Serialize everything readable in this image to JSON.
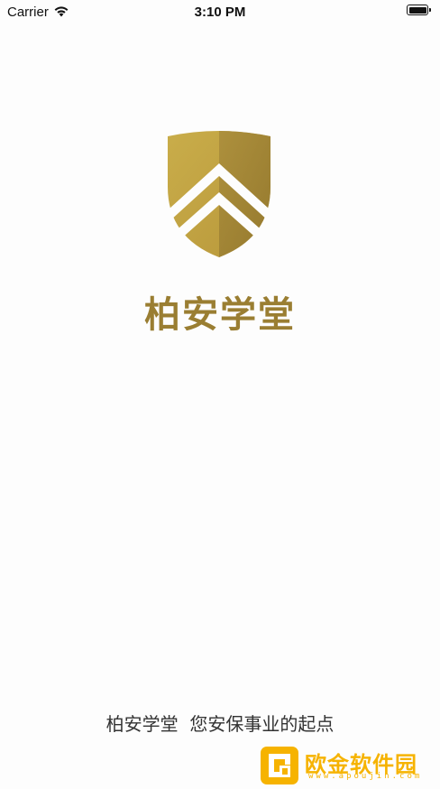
{
  "status_bar": {
    "carrier": "Carrier",
    "time": "3:10 PM",
    "wifi_icon": "wifi-icon",
    "battery_icon": "battery-icon"
  },
  "brand": {
    "name": "柏安学堂",
    "logo_icon": "shield-chevron-logo",
    "color": "#9a7e32"
  },
  "slogan": "柏安学堂  您安保事业的起点",
  "watermark": {
    "title": "欧金软件园",
    "url": "www.apoujin.com",
    "color": "#f6b300"
  }
}
